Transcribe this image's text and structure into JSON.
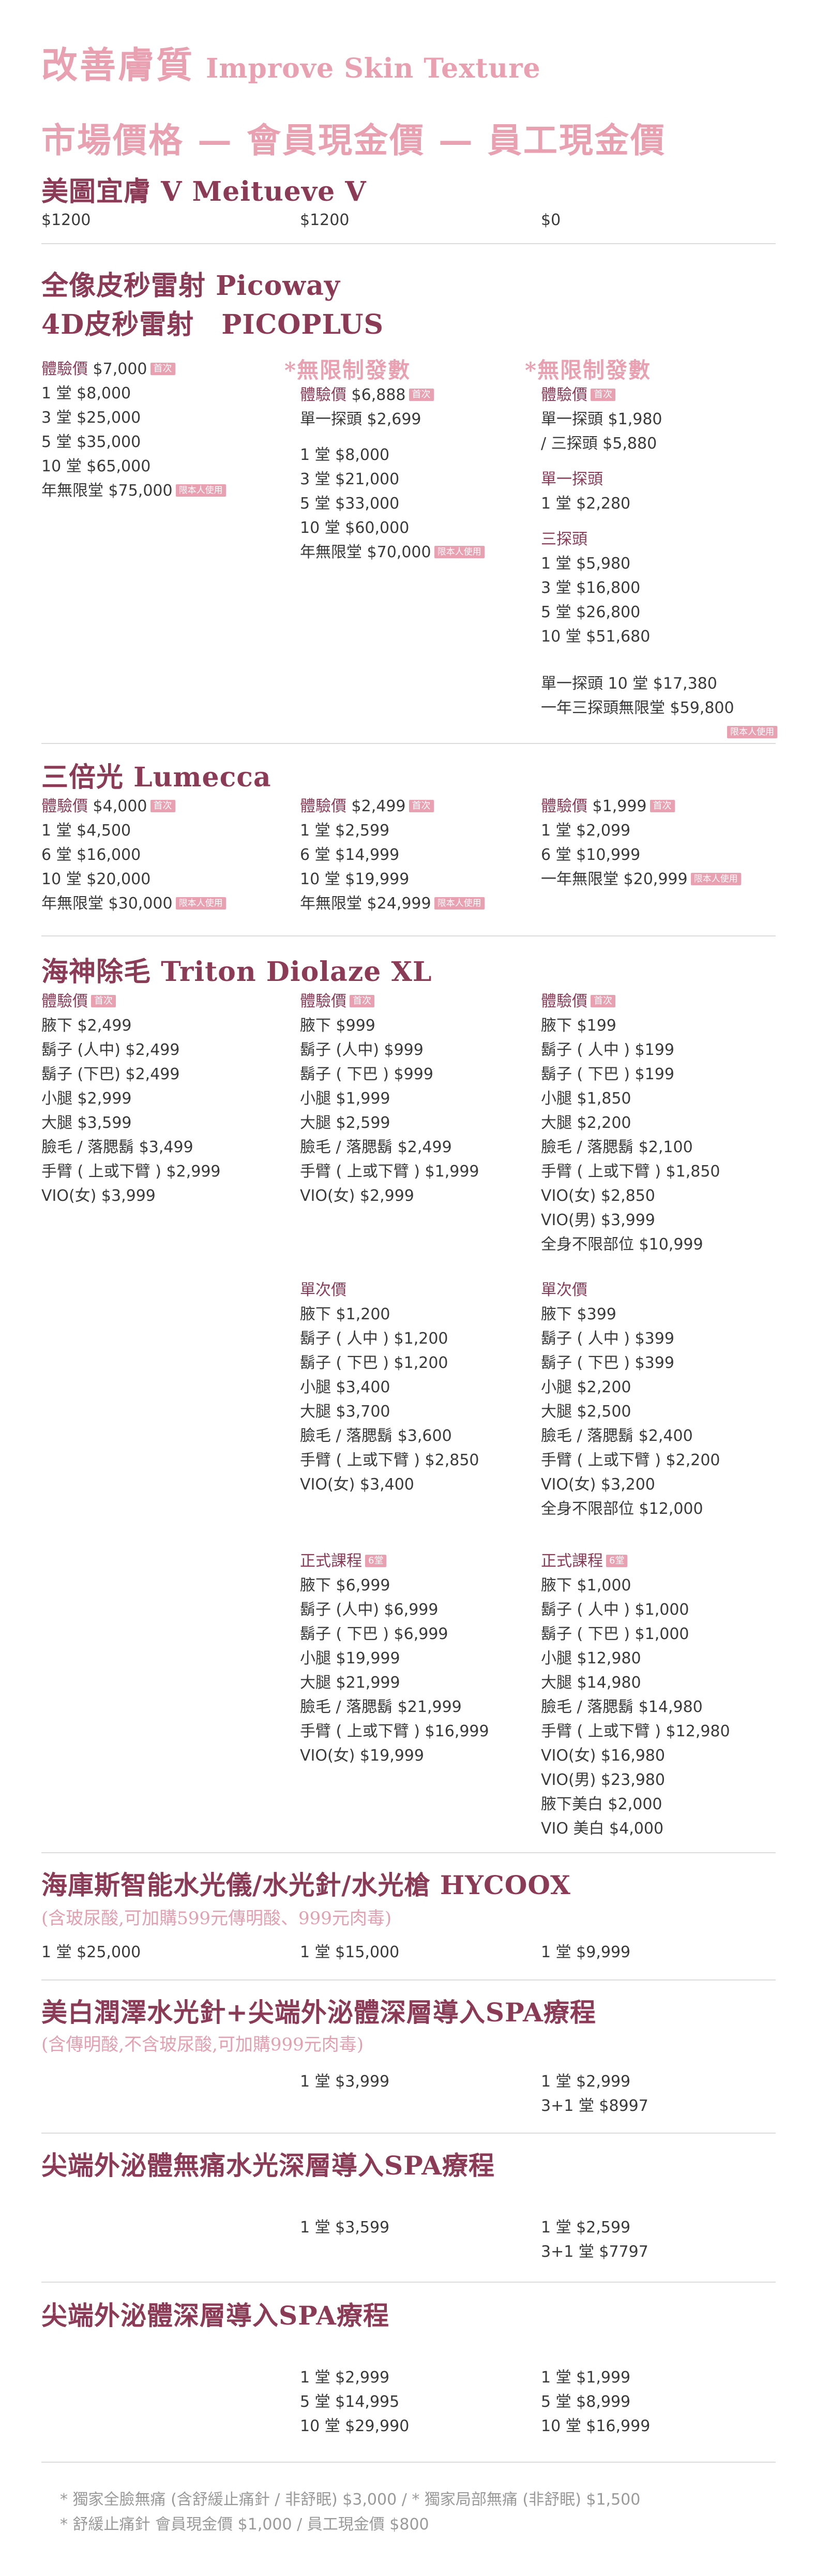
{
  "header": {
    "title_zh": "改善膚質",
    "title_en": "Improve Skin Texture",
    "price_columns": "市場價格 — 會員現金價 — 員工現金價"
  },
  "meitueve": {
    "title": "美圖宜膚 V Meitueve V",
    "col1": [
      "$1200"
    ],
    "col2": [
      "$1200"
    ],
    "col3": [
      "$0"
    ]
  },
  "picoway": {
    "title1": "全像皮秒雷射 Picoway",
    "title2": "4D皮秒雷射　PICOPLUS",
    "unlimited2": "*無限制發數",
    "unlimited3": "*無限制發數",
    "c1_exp_label": "體驗價",
    "c1_exp_price": " $7,000",
    "tag_first": "首次",
    "tag_self": "限本人使用",
    "c1": [
      "1 堂 $8,000",
      "3 堂 $25,000",
      "5 堂 $35,000",
      "10 堂 $65,000"
    ],
    "c1_year": "年無限堂 $75,000",
    "c2_exp_label": "體驗價",
    "c2_exp_price": " $6,888",
    "c2_single": "單一探頭 $2,699",
    "c2": [
      "1 堂 $8,000",
      "3 堂 $21,000",
      "5 堂 $33,000",
      "10 堂 $60,000"
    ],
    "c2_year": "年無限堂 $70,000",
    "c3_exp_label": "體驗價",
    "c3_exp": [
      "單一探頭 $1,980",
      "/ 三探頭 $5,880"
    ],
    "c3_single_label": "單一探頭",
    "c3_single": [
      "1 堂 $2,280"
    ],
    "c3_three_label": "三探頭",
    "c3_three": [
      "1 堂 $5,980",
      "3 堂 $16,800",
      "5 堂 $26,800",
      "10 堂 $51,680"
    ],
    "c3_extra": [
      "單一探頭 10 堂 $17,380",
      "一年三探頭無限堂 $59,800"
    ]
  },
  "lumecca": {
    "title": "三倍光 Lumecca",
    "c1_exp_label": "體驗價",
    "c1_exp_price": " $4,000",
    "c1": [
      "1 堂 $4,500",
      "6 堂 $16,000",
      "10 堂 $20,000"
    ],
    "c1_year": "年無限堂 $30,000",
    "c2_exp_label": "體驗價",
    "c2_exp_price": " $2,499",
    "c2": [
      "1 堂 $2,599",
      "6 堂 $14,999",
      "10 堂 $19,999"
    ],
    "c2_year": "年無限堂 $24,999",
    "c3_exp_label": "體驗價",
    "c3_exp_price": " $1,999",
    "c3": [
      "1 堂 $2,099",
      "6 堂 $10,999"
    ],
    "c3_year": "一年無限堂 $20,999"
  },
  "triton": {
    "title": "海神除毛 Triton Diolaze XL",
    "exp_label": "體驗價",
    "single_label": "單次價",
    "course_label": "正式課程",
    "tag_6": "6堂",
    "c1_exp": [
      "腋下 $2,499",
      "鬍子 (人中) $2,499",
      "鬍子 (下巴) $2,499",
      "小腿 $2,999",
      "大腿 $3,599",
      "臉毛 / 落腮鬍 $3,499",
      "手臂 ( 上或下臂 ) $2,999",
      "VIO(女) $3,999"
    ],
    "c2_exp": [
      "腋下 $999",
      "鬍子 (人中) $999",
      "鬍子 ( 下巴 ) $999",
      "小腿 $1,999",
      "大腿 $2,599",
      "臉毛 / 落腮鬍 $2,499",
      "手臂 ( 上或下臂 ) $1,999",
      "VIO(女) $2,999"
    ],
    "c3_exp": [
      "腋下 $199",
      "鬍子 ( 人中 ) $199",
      "鬍子 ( 下巴 ) $199",
      "小腿 $1,850",
      "大腿 $2,200",
      "臉毛 / 落腮鬍 $2,100",
      "手臂 ( 上或下臂 ) $1,850",
      "VIO(女) $2,850",
      "VIO(男) $3,999",
      "全身不限部位 $10,999"
    ],
    "c2_single": [
      "腋下 $1,200",
      "鬍子 ( 人中 ) $1,200",
      "鬍子 ( 下巴 ) $1,200",
      "小腿 $3,400",
      "大腿 $3,700",
      "臉毛 / 落腮鬍 $3,600",
      "手臂 ( 上或下臂 ) $2,850",
      "VIO(女) $3,400"
    ],
    "c3_single": [
      "腋下 $399",
      "鬍子 ( 人中 ) $399",
      "鬍子 ( 下巴 ) $399",
      "小腿 $2,200",
      "大腿 $2,500",
      "臉毛 / 落腮鬍 $2,400",
      "手臂 ( 上或下臂 ) $2,200",
      "VIO(女) $3,200",
      "全身不限部位 $12,000"
    ],
    "c2_course": [
      "腋下 $6,999",
      "鬍子 (人中) $6,999",
      "鬍子 ( 下巴 ) $6,999",
      "小腿 $19,999",
      "大腿 $21,999",
      "臉毛 / 落腮鬍 $21,999",
      "手臂 ( 上或下臂 ) $16,999",
      "VIO(女) $19,999"
    ],
    "c3_course": [
      "腋下 $1,000",
      "鬍子 ( 人中 ) $1,000",
      "鬍子 ( 下巴 ) $1,000",
      "小腿 $12,980",
      "大腿 $14,980",
      "臉毛 / 落腮鬍 $14,980",
      "手臂 ( 上或下臂 ) $12,980",
      "VIO(女) $16,980",
      "VIO(男) $23,980",
      "腋下美白 $2,000",
      "VIO 美白 $4,000"
    ]
  },
  "hycoox": {
    "title": "海庫斯智能水光儀/水光針/水光槍 HYCOOX",
    "subtitle": "(含玻尿酸,可加購599元傳明酸、999元肉毒)",
    "c1": [
      "1 堂 $25,000"
    ],
    "c2": [
      "1 堂 $15,000"
    ],
    "c3": [
      "1 堂 $9,999"
    ]
  },
  "whitening": {
    "title": "美白潤澤水光針+尖端外泌體深層導入SPA療程",
    "subtitle": "(含傳明酸,不含玻尿酸,可加購999元肉毒)",
    "c2": [
      "1 堂 $3,999"
    ],
    "c3": [
      "1 堂 $2,999",
      "3+1 堂 $8997"
    ]
  },
  "exosome_painless": {
    "title": "尖端外泌體無痛水光深層導入SPA療程",
    "c2": [
      "1 堂 $3,599"
    ],
    "c3": [
      "1 堂 $2,599",
      "3+1 堂 $7797"
    ]
  },
  "exosome_spa": {
    "title": "尖端外泌體深層導入SPA療程",
    "c2": [
      "1 堂 $2,999",
      "5 堂 $14,995",
      "10 堂 $29,990"
    ],
    "c3": [
      "1 堂 $1,999",
      "5 堂 $8,999",
      "10 堂 $16,999"
    ]
  },
  "notes": [
    "* 獨家全臉無痛 (含舒緩止痛針 / 非舒眠) $3,000 / * 獨家局部無痛 (非舒眠) $1,500",
    "* 舒緩止痛針 會員現金價 $1,000 / 員工現金價 $800"
  ]
}
